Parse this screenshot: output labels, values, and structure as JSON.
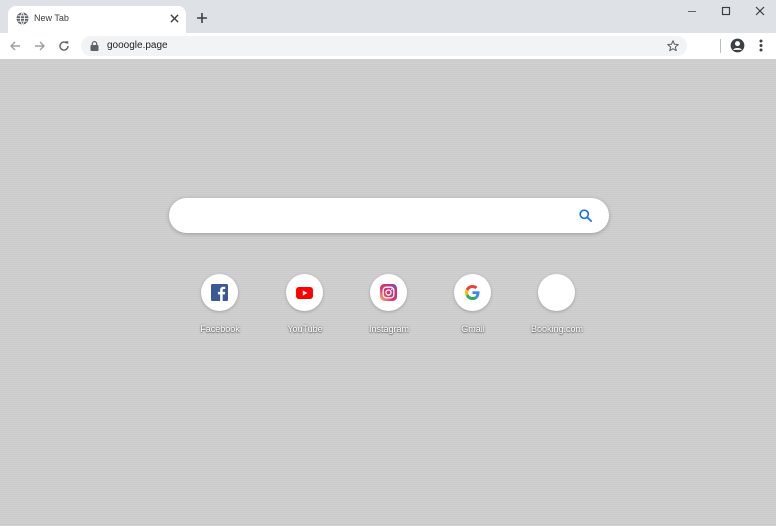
{
  "tab": {
    "title": "New Tab"
  },
  "toolbar": {
    "url": "gooogle.page"
  },
  "search": {
    "placeholder": ""
  },
  "shortcuts": [
    {
      "label": "Facebook",
      "icon": "facebook-icon"
    },
    {
      "label": "YouTube",
      "icon": "youtube-icon"
    },
    {
      "label": "Instagram",
      "icon": "instagram-icon"
    },
    {
      "label": "Gmail",
      "icon": "google-g-icon"
    },
    {
      "label": "Booking.com",
      "icon": "blank-icon"
    }
  ],
  "colors": {
    "accent_blue": "#1a73e8",
    "facebook_blue": "#3b5998",
    "youtube_red": "#ff0000",
    "tab_strip": "#dee1e6",
    "page_background": "#cbcbcb"
  }
}
